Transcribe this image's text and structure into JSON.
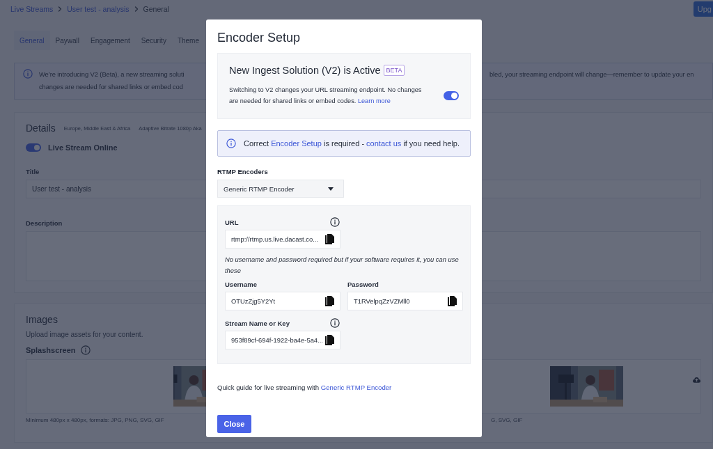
{
  "breadcrumb": [
    {
      "label": "Live Streams",
      "kind": "link"
    },
    {
      "label": "User test - analysis",
      "kind": "link"
    },
    {
      "label": "General",
      "kind": "current"
    }
  ],
  "upgrade_button": {
    "label": "Upg"
  },
  "tabs": [
    {
      "label": "General",
      "selected": true
    },
    {
      "label": "Paywall",
      "selected": false
    },
    {
      "label": "Engagement",
      "selected": false
    },
    {
      "label": "Security",
      "selected": false
    },
    {
      "label": "Theme",
      "selected": false
    }
  ],
  "banner": {
    "line_1_left": "We’re introducing V2 (Beta), a new streaming soluti",
    "line_1_right": "bled, your streaming endpoint will change—remember to update your en",
    "line_2": "changes are needed for shared links or embed cod"
  },
  "details": {
    "title": "Details",
    "tags": [
      "Europe, Middle East & Africa",
      "Adaptive Bitrate 1080p Aka"
    ],
    "online_toggle": {
      "label": "Live Stream Online",
      "on": true
    },
    "title_field": {
      "label": "Title",
      "value": "User test - analysis"
    },
    "description_field": {
      "label": "Description"
    }
  },
  "images": {
    "title": "Images",
    "subtitle": "Upload image assets for your content.",
    "splashscreen": {
      "label": "Splashscreen",
      "hint_left": "Minimum 480px x 480px, formats: JPG, PNG, SVG, GIF",
      "hint_right": "G, SVG, GIF"
    }
  },
  "modal": {
    "title": "Encoder Setup",
    "ingest": {
      "title": "New Ingest Solution (V2) is Active",
      "badge": "BETA",
      "text": "Switching to V2 changes your URL streaming endpoint. No changes are needed for shared links or embed codes.",
      "link": "Learn more",
      "on": true
    },
    "alert": {
      "segments": [
        {
          "kind": "text",
          "text": "Correct "
        },
        {
          "kind": "link",
          "text": "Encoder Setup"
        },
        {
          "kind": "text",
          "text": " is required - "
        },
        {
          "kind": "link",
          "text": "contact us"
        },
        {
          "kind": "text",
          "text": " if you need help."
        }
      ]
    },
    "encoder": {
      "label": "RTMP Encoders",
      "value": "Generic RTMP Encoder"
    },
    "credentials": {
      "url": {
        "label": "URL",
        "value": "rtmp://rtmp.us.live.dacast.co...",
        "info": true
      },
      "note": "No username and password required but if your software requires it, you can use these",
      "username": {
        "label": "Username",
        "value": "OTUzZjg5Y2Yt",
        "info": false
      },
      "password": {
        "label": "Password",
        "value": "T1RVelpqZzVZMll0",
        "info": false
      },
      "stream_key": {
        "label": "Stream Name or Key",
        "value": "953f89cf-694f-1922-ba4e-5a4...",
        "info": true
      }
    },
    "guide": {
      "text": "Quick guide for live streaming with ",
      "link": "Generic RTMP Encoder"
    },
    "close_button": "Close"
  }
}
